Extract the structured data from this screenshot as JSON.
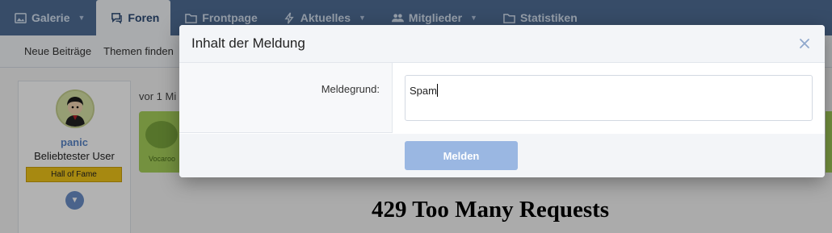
{
  "topnav": {
    "tabs": [
      {
        "label": "Galerie",
        "icon": "image-icon",
        "dropdown": true
      },
      {
        "label": "Foren",
        "icon": "chat-icon",
        "dropdown": true,
        "active": true
      },
      {
        "label": "Frontpage",
        "icon": "folder-icon",
        "dropdown": false
      },
      {
        "label": "Aktuelles",
        "icon": "bolt-icon",
        "dropdown": true
      },
      {
        "label": "Mitglieder",
        "icon": "users-icon",
        "dropdown": true
      },
      {
        "label": "Statistiken",
        "icon": "folder-icon",
        "dropdown": false
      }
    ]
  },
  "subnav": {
    "items": [
      "Neue Beiträge",
      "Themen finden"
    ]
  },
  "user": {
    "name": "panic",
    "title": "Beliebtester User",
    "badge": "Hall of Fame"
  },
  "post": {
    "time": "vor 1 Mi",
    "embed_label": "Vocaroo"
  },
  "error": {
    "heading": "429 Too Many Requests"
  },
  "dialog": {
    "title": "Inhalt der Meldung",
    "field_label": "Meldegrund:",
    "field_value": "Spam",
    "submit_label": "Melden"
  },
  "colors": {
    "nav_bg": "#4f6e96",
    "accent": "#5a86c7",
    "submit_disabled": "#9ab7e2",
    "badge": "#f0c419",
    "embed_green": "#a7d05b"
  }
}
